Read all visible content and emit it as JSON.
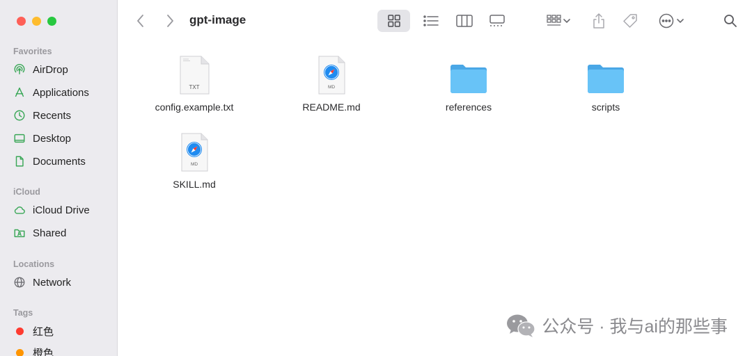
{
  "window": {
    "title": "gpt-image"
  },
  "sidebar": {
    "sections": [
      {
        "title": "Favorites"
      },
      {
        "title": "iCloud"
      },
      {
        "title": "Locations"
      },
      {
        "title": "Tags"
      }
    ],
    "favorites": [
      {
        "label": "AirDrop",
        "icon": "airdrop-icon"
      },
      {
        "label": "Applications",
        "icon": "applications-icon"
      },
      {
        "label": "Recents",
        "icon": "clock-icon"
      },
      {
        "label": "Desktop",
        "icon": "desktop-icon"
      },
      {
        "label": "Documents",
        "icon": "document-icon"
      }
    ],
    "icloud": [
      {
        "label": "iCloud Drive",
        "icon": "cloud-icon"
      },
      {
        "label": "Shared",
        "icon": "shared-folder-icon"
      }
    ],
    "locations": [
      {
        "label": "Network",
        "icon": "globe-icon"
      }
    ],
    "tags": [
      {
        "label": "红色",
        "color": "#fe3b30"
      },
      {
        "label": "橙色",
        "color": "#ff9500"
      }
    ]
  },
  "files": [
    {
      "name": "config.example.txt",
      "type": "txt",
      "badge": "TXT"
    },
    {
      "name": "README.md",
      "type": "md",
      "badge": "MD"
    },
    {
      "name": "references",
      "type": "folder"
    },
    {
      "name": "scripts",
      "type": "folder"
    },
    {
      "name": "SKILL.md",
      "type": "md",
      "badge": "MD"
    }
  ],
  "watermark": {
    "text": "公众号 · 我与ai的那些事"
  },
  "colors": {
    "sidebar_bg": "#ecebef",
    "accent_green": "#34a853",
    "folder_blue": "#5ab8f0"
  }
}
